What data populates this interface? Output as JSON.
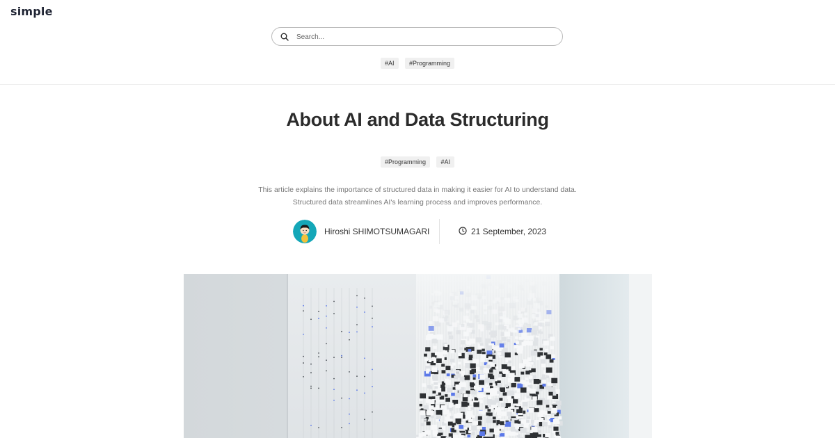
{
  "site": {
    "logo": "simple"
  },
  "search": {
    "placeholder": "Search..."
  },
  "header_tags": [
    "#AI",
    "#Programming"
  ],
  "article": {
    "title": "About AI and Data Structuring",
    "tags": [
      "#Programming",
      "#AI"
    ],
    "description": "This article explains the importance of structured data in making it easier for AI to understand data. Structured data streamlines AI's learning process and improves performance.",
    "author": "Hiroshi SHIMOTSUMAGARI",
    "date": "21 September, 2023"
  },
  "colors": {
    "logo": "#1f2433",
    "title": "#2b2b2b",
    "tag_bg": "#f0f0f0",
    "avatar_bg": "#14a7b8",
    "cube_accent": "#5b78e8"
  },
  "icons": {
    "search": "search-icon",
    "clock": "clock-icon"
  }
}
